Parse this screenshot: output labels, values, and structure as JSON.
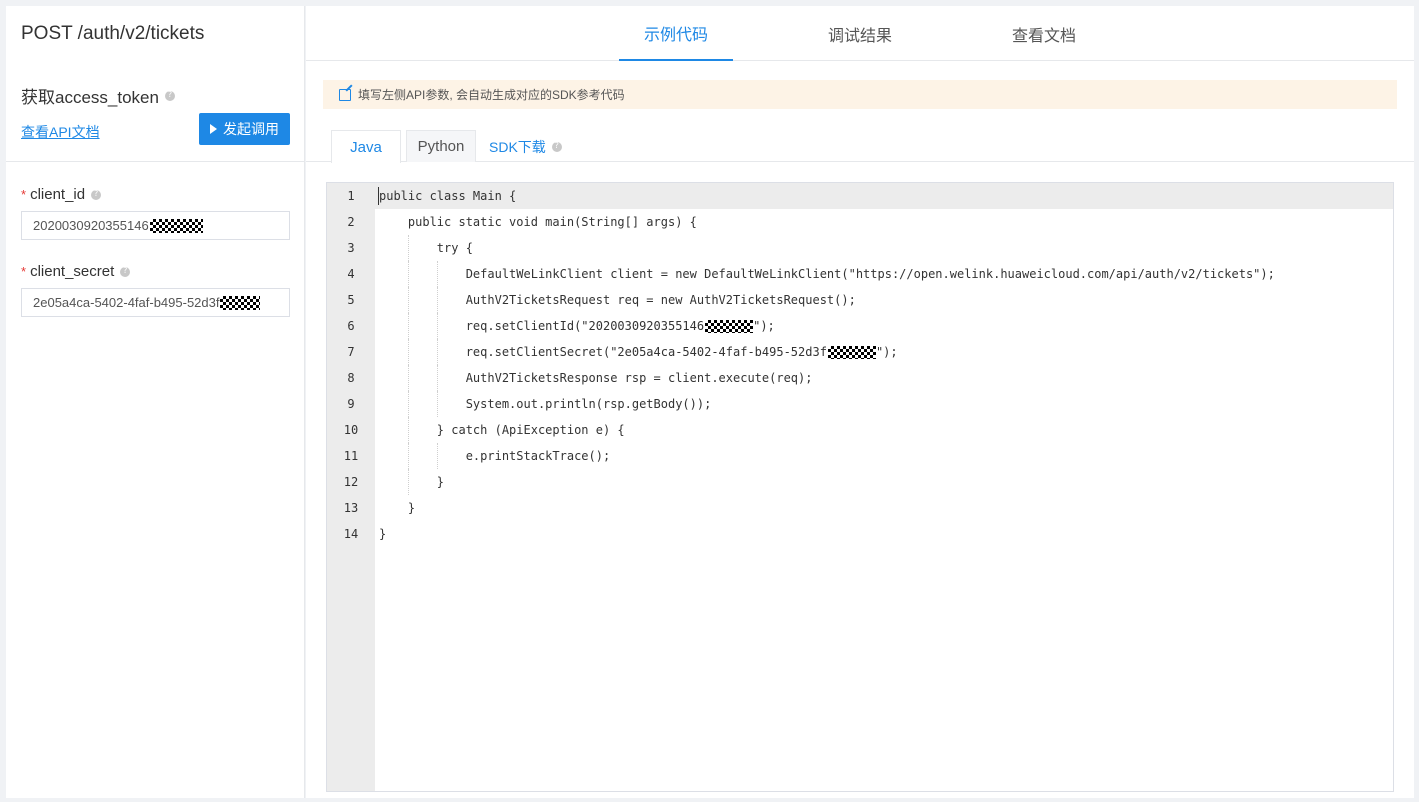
{
  "left": {
    "api_title": "POST /auth/v2/tickets",
    "api_desc": "获取access_token",
    "doc_link": "查看API文档",
    "invoke_button": "发起调用",
    "fields": [
      {
        "label": "client_id",
        "required": true,
        "value": "2020030920355146"
      },
      {
        "label": "client_secret",
        "required": true,
        "value": "2e05a4ca-5402-4faf-b495-52d3f"
      }
    ]
  },
  "tabs": {
    "items": [
      "示例代码",
      "调试结果",
      "查看文档"
    ],
    "active": "示例代码"
  },
  "notice": "填写左侧API参数, 会自动生成对应的SDK参考代码",
  "lang_tabs": {
    "items": [
      "Java",
      "Python"
    ],
    "active": "Java",
    "sdk_download": "SDK下载"
  },
  "code": {
    "lines": [
      {
        "n": "1",
        "text": "public class Main {"
      },
      {
        "n": "2",
        "text": "    public static void main(String[] args) {"
      },
      {
        "n": "3",
        "text": "        try {"
      },
      {
        "n": "4",
        "text": "            DefaultWeLinkClient client = new DefaultWeLinkClient(\"https://open.welink.huaweicloud.com/api/auth/v2/tickets\");"
      },
      {
        "n": "5",
        "text": "            AuthV2TicketsRequest req = new AuthV2TicketsRequest();"
      },
      {
        "n": "6",
        "text": "            req.setClientId(\"2020030920355146",
        "tail": "\");",
        "masked": true
      },
      {
        "n": "7",
        "text": "            req.setClientSecret(\"2e05a4ca-5402-4faf-b495-52d3f",
        "tail": "\");",
        "masked": true
      },
      {
        "n": "8",
        "text": "            AuthV2TicketsResponse rsp = client.execute(req);"
      },
      {
        "n": "9",
        "text": "            System.out.println(rsp.getBody());"
      },
      {
        "n": "10",
        "text": "        } catch (ApiException e) {"
      },
      {
        "n": "11",
        "text": "            e.printStackTrace();"
      },
      {
        "n": "12",
        "text": "        }"
      },
      {
        "n": "13",
        "text": "    }"
      },
      {
        "n": "14",
        "text": "}"
      }
    ]
  },
  "colors": {
    "accent": "#1e88e5",
    "notice_bg": "#fdf3e6",
    "required": "#e53935"
  }
}
